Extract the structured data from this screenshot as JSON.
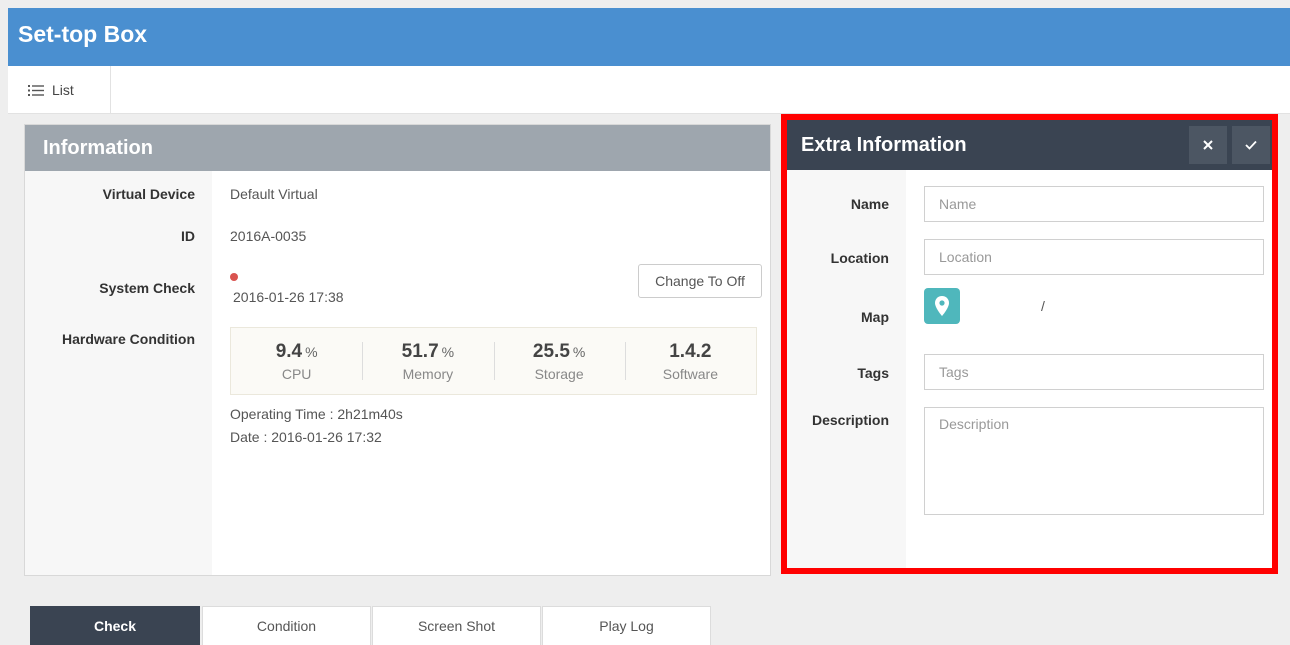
{
  "app": {
    "title": "Set-top Box"
  },
  "toolbar": {
    "list_label": "List",
    "list_icon": "list-icon"
  },
  "info": {
    "title": "Information",
    "virtual_device_label": "Virtual Device",
    "virtual_device_value": "Default Virtual",
    "id_label": "ID",
    "id_value": "2016A-0035",
    "system_check_label": "System Check",
    "system_check_time": "2016-01-26 17:38",
    "system_check_status_color": "#d9534f",
    "change_button": "Change To Off",
    "hardware_label": "Hardware Condition",
    "hardware": [
      {
        "value": "9.4",
        "unit": "%",
        "name": "CPU"
      },
      {
        "value": "51.7",
        "unit": "%",
        "name": "Memory"
      },
      {
        "value": "25.5",
        "unit": "%",
        "name": "Storage"
      },
      {
        "value": "1.4.2",
        "unit": "",
        "name": "Software"
      }
    ],
    "operating_time": "Operating Time : 2h21m40s",
    "date": "Date : 2016-01-26 17:32"
  },
  "extra": {
    "title": "Extra Information",
    "close_icon": "close-icon",
    "confirm_icon": "check-icon",
    "name_label": "Name",
    "name_placeholder": "Name",
    "location_label": "Location",
    "location_placeholder": "Location",
    "map_label": "Map",
    "map_separator": "/",
    "tags_label": "Tags",
    "tags_placeholder": "Tags",
    "description_label": "Description",
    "description_placeholder": "Description"
  },
  "tabs": [
    {
      "label": "Check",
      "active": true
    },
    {
      "label": "Condition",
      "active": false
    },
    {
      "label": "Screen Shot",
      "active": false
    },
    {
      "label": "Play Log",
      "active": false
    }
  ],
  "colors": {
    "header": "#4a8fd0",
    "panel_dark": "#3a4452",
    "accent_map": "#4fb7bc",
    "highlight": "#ff0000"
  }
}
